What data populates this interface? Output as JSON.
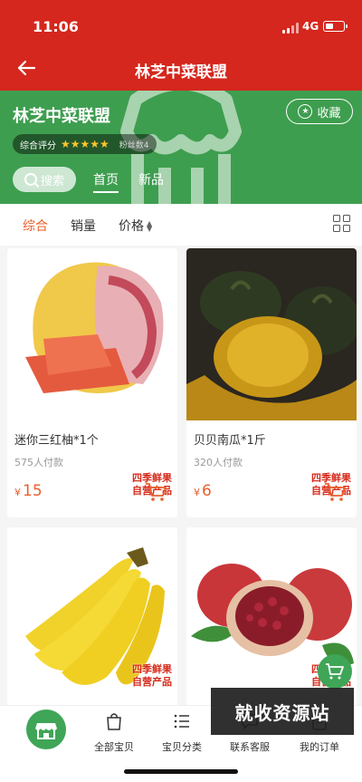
{
  "status": {
    "time": "11:06",
    "network": "4G"
  },
  "nav": {
    "title": "林芝中菜联盟"
  },
  "shop": {
    "name": "林芝中菜联盟",
    "favorite_label": "收藏",
    "rating_label": "综合评分",
    "rating_stars": "★★★★★",
    "fans_label": "粉丝数4",
    "search_label": "搜索",
    "tabs": [
      "首页",
      "新品"
    ]
  },
  "sort": {
    "options": [
      "综合",
      "销量",
      "价格"
    ]
  },
  "products": [
    {
      "name": "迷你三红柚*1个",
      "sold": "575人付款",
      "currency": "¥",
      "price": "15",
      "tag_line1": "四季鲜果",
      "tag_line2": "自营产品",
      "icon": "pomelo"
    },
    {
      "name": "贝贝南瓜*1斤",
      "sold": "320人付款",
      "currency": "¥",
      "price": "6",
      "tag_line1": "四季鲜果",
      "tag_line2": "自营产品",
      "icon": "pumpkin"
    },
    {
      "name": "",
      "sold": "",
      "currency": "",
      "price": "",
      "tag_line1": "四季鲜果",
      "tag_line2": "自营产品",
      "icon": "banana"
    },
    {
      "name": "",
      "sold": "",
      "currency": "",
      "price": "",
      "tag_line1": "四季鲜果",
      "tag_line2": "自营产品",
      "icon": "pomegranate"
    }
  ],
  "bottom_nav": {
    "items": [
      "全部宝贝",
      "宝贝分类",
      "联系客服",
      "我的订单"
    ]
  },
  "watermark_badge": "就收资源站",
  "colors": {
    "brand_red": "#d5271d",
    "shop_green": "#3e9e4f",
    "accent_orange": "#e8602c"
  }
}
